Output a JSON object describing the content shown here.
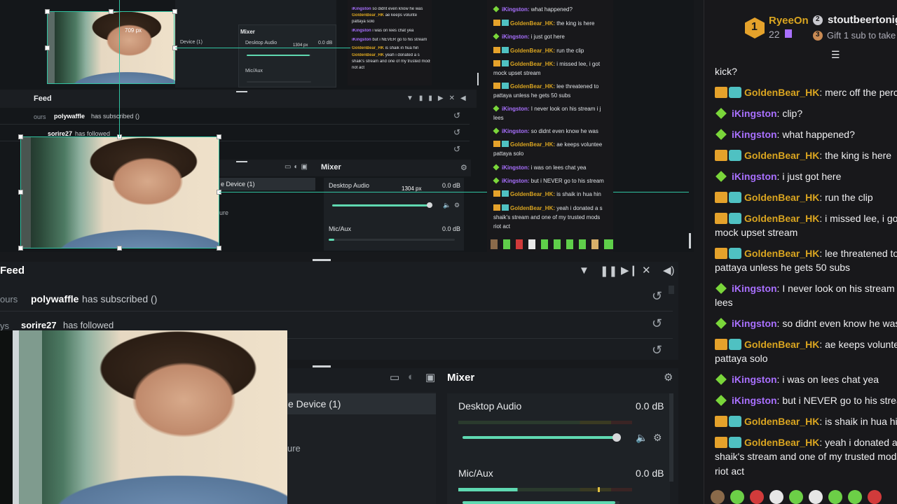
{
  "colors": {
    "accent": "#31c3a2",
    "chat_bg": "#18181b",
    "obs_bg": "#17191c",
    "username_purple": "#a970ff",
    "username_gold": "#daa520"
  },
  "mini": {
    "feed_title": "Feed",
    "hours_label": "ours",
    "event1_user": "polywaffle",
    "event1_text": "has subscribed ()",
    "event2_user": "sorire27",
    "event2_text": "has followed",
    "mixer_title": "Mixer",
    "device_label": "e Device (1)",
    "desktop_audio": "Desktop Audio",
    "desktop_db": "0.0 dB",
    "mic_aux": "Mic/Aux",
    "mic_db": "0.0 dB",
    "dimension_label": "1304 px",
    "top_dim_label": "709 px",
    "ure_label": "ure",
    "tiny_desktop_audio": "Desktop Audio",
    "tiny_db": "0.0 dB",
    "tiny_device": "Device (1)",
    "tiny_mic": "Mic/Aux",
    "tiny_mixer": "Mixer",
    "tiny_px": "1304 px",
    "tiny_feed_user1": "pop",
    "tiny_feed_user2": "sorire2"
  },
  "feed": {
    "title": "Feed",
    "rows": [
      {
        "prefix": "ours",
        "user": "polywaffle",
        "text": "has subscribed ()"
      },
      {
        "prefix": "ys",
        "user": "sorire27",
        "text": "has followed"
      }
    ]
  },
  "mixer": {
    "title": "Mixer",
    "device_label": "e Device (1)",
    "ure_label": "ure",
    "channels": [
      {
        "name": "Desktop Audio",
        "db": "0.0 dB",
        "level": 0.97
      },
      {
        "name": "Mic/Aux",
        "db": "0.0 dB",
        "level": 0.97
      }
    ]
  },
  "mini_chat": [
    {
      "badges": "gem",
      "user": "iKingston",
      "color": "g",
      "text": "what happened?"
    },
    {
      "badges": "crown-sub",
      "user": "GoldenBear_HK",
      "color": "y",
      "text": "the king is here"
    },
    {
      "badges": "gem",
      "user": "iKingston",
      "color": "g",
      "text": "i just got here"
    },
    {
      "badges": "crown-sub",
      "user": "GoldenBear_HK",
      "color": "y",
      "text": "run the clip"
    },
    {
      "badges": "crown-sub",
      "user": "GoldenBear_HK",
      "color": "y",
      "text": "i missed lee, i got"
    },
    {
      "badges": "none",
      "user": "",
      "color": "",
      "text": "mock upset stream"
    },
    {
      "badges": "crown-sub",
      "user": "GoldenBear_HK",
      "color": "y",
      "text": "lee threatened to"
    },
    {
      "badges": "none",
      "user": "",
      "color": "",
      "text": "pattaya unless he gets 50 subs"
    },
    {
      "badges": "gem",
      "user": "iKingston",
      "color": "g",
      "text": "I never look on his stream i j"
    },
    {
      "badges": "none",
      "user": "",
      "color": "",
      "text": "lees"
    },
    {
      "badges": "gem",
      "user": "iKingston",
      "color": "g",
      "text": "so didnt even know he was"
    },
    {
      "badges": "crown-sub",
      "user": "GoldenBear_HK",
      "color": "y",
      "text": "ae keeps voluntee"
    },
    {
      "badges": "none",
      "user": "",
      "color": "",
      "text": "pattaya solo"
    },
    {
      "badges": "gem",
      "user": "iKingston",
      "color": "g",
      "text": "i was on lees chat yea"
    },
    {
      "badges": "gem",
      "user": "iKingston",
      "color": "g",
      "text": "but i NEVER go to his stream"
    },
    {
      "badges": "crown-sub",
      "user": "GoldenBear_HK",
      "color": "y",
      "text": "is shaik in hua hin"
    },
    {
      "badges": "crown-sub",
      "user": "GoldenBear_HK",
      "color": "y",
      "text": "yeah i donated a s"
    },
    {
      "badges": "none",
      "user": "",
      "color": "",
      "text": "shaik's stream and one of my trusted mods"
    },
    {
      "badges": "none",
      "user": "",
      "color": "",
      "text": "riot act"
    }
  ],
  "tiny_chat": [
    {
      "user": "iKingston",
      "color": "g",
      "text": "so didnt even know he was"
    },
    {
      "user": "GoldenBear_HK",
      "color": "y",
      "text": "ae keeps volunte"
    },
    {
      "user": "",
      "color": "",
      "text": "pattaya solo"
    },
    {
      "user": "iKingston",
      "color": "g",
      "text": "i was on lees chat yea"
    },
    {
      "user": "iKingston",
      "color": "g",
      "text": "but i NEVER go to his stream"
    },
    {
      "user": "GoldenBear_HK",
      "color": "y",
      "text": "is shaik in hua hin"
    },
    {
      "user": "GoldenBear_HK",
      "color": "y",
      "text": "yeah i donated a s"
    },
    {
      "user": "",
      "color": "",
      "text": "shaik's stream and one of my trusted mods"
    },
    {
      "user": "",
      "color": "",
      "text": "riot act"
    }
  ],
  "chat": {
    "leaderboard": [
      {
        "rank": "1",
        "name": "RyeeOn",
        "count": "22"
      },
      {
        "rank": "2",
        "name": "stoutbeertonig",
        "count": ""
      },
      {
        "rank": "3",
        "name": "Gift 1 sub to take",
        "count": ""
      }
    ],
    "messages": [
      {
        "badges": "none",
        "user": "",
        "color": "",
        "text": "kick?"
      },
      {
        "badges": "crown-sub",
        "user": "GoldenBear_HK",
        "color": "y",
        "text": ": merc off the perc"
      },
      {
        "badges": "gem",
        "user": "iKingston",
        "color": "g",
        "text": ": clip?"
      },
      {
        "badges": "gem",
        "user": "iKingston",
        "color": "g",
        "text": ": what happened?"
      },
      {
        "badges": "crown-sub",
        "user": "GoldenBear_HK",
        "color": "y",
        "text": ": the king is here"
      },
      {
        "badges": "gem",
        "user": "iKingston",
        "color": "g",
        "text": ": i just got here"
      },
      {
        "badges": "crown-sub",
        "user": "GoldenBear_HK",
        "color": "y",
        "text": ": run the clip"
      },
      {
        "badges": "crown-sub",
        "user": "GoldenBear_HK",
        "color": "y",
        "text": ": i missed lee, i got"
      },
      {
        "badges": "none",
        "user": "",
        "color": "",
        "text": "mock upset stream"
      },
      {
        "badges": "crown-sub",
        "user": "GoldenBear_HK",
        "color": "y",
        "text": ": lee threatened to"
      },
      {
        "badges": "none",
        "user": "",
        "color": "",
        "text": "pattaya unless he gets 50 subs"
      },
      {
        "badges": "gem",
        "user": "iKingston",
        "color": "g",
        "text": ": I never look on his stream i j"
      },
      {
        "badges": "none",
        "user": "",
        "color": "",
        "text": "lees"
      },
      {
        "badges": "gem",
        "user": "iKingston",
        "color": "g",
        "text": ": so didnt even know he was"
      },
      {
        "badges": "crown-sub",
        "user": "GoldenBear_HK",
        "color": "y",
        "text": ": ae keeps voluntee"
      },
      {
        "badges": "none",
        "user": "",
        "color": "",
        "text": "pattaya solo"
      },
      {
        "badges": "gem",
        "user": "iKingston",
        "color": "g",
        "text": ": i was on lees chat yea"
      },
      {
        "badges": "gem",
        "user": "iKingston",
        "color": "g",
        "text": ": but i NEVER go to his stream"
      },
      {
        "badges": "crown-sub",
        "user": "GoldenBear_HK",
        "color": "y",
        "text": ": is shaik in hua hin"
      },
      {
        "badges": "crown-sub",
        "user": "GoldenBear_HK",
        "color": "y",
        "text": ": yeah i donated a s"
      },
      {
        "badges": "none",
        "user": "",
        "color": "",
        "text": "shaik's stream and one of my trusted mods"
      },
      {
        "badges": "none",
        "user": "",
        "color": "",
        "text": "riot act"
      }
    ]
  }
}
